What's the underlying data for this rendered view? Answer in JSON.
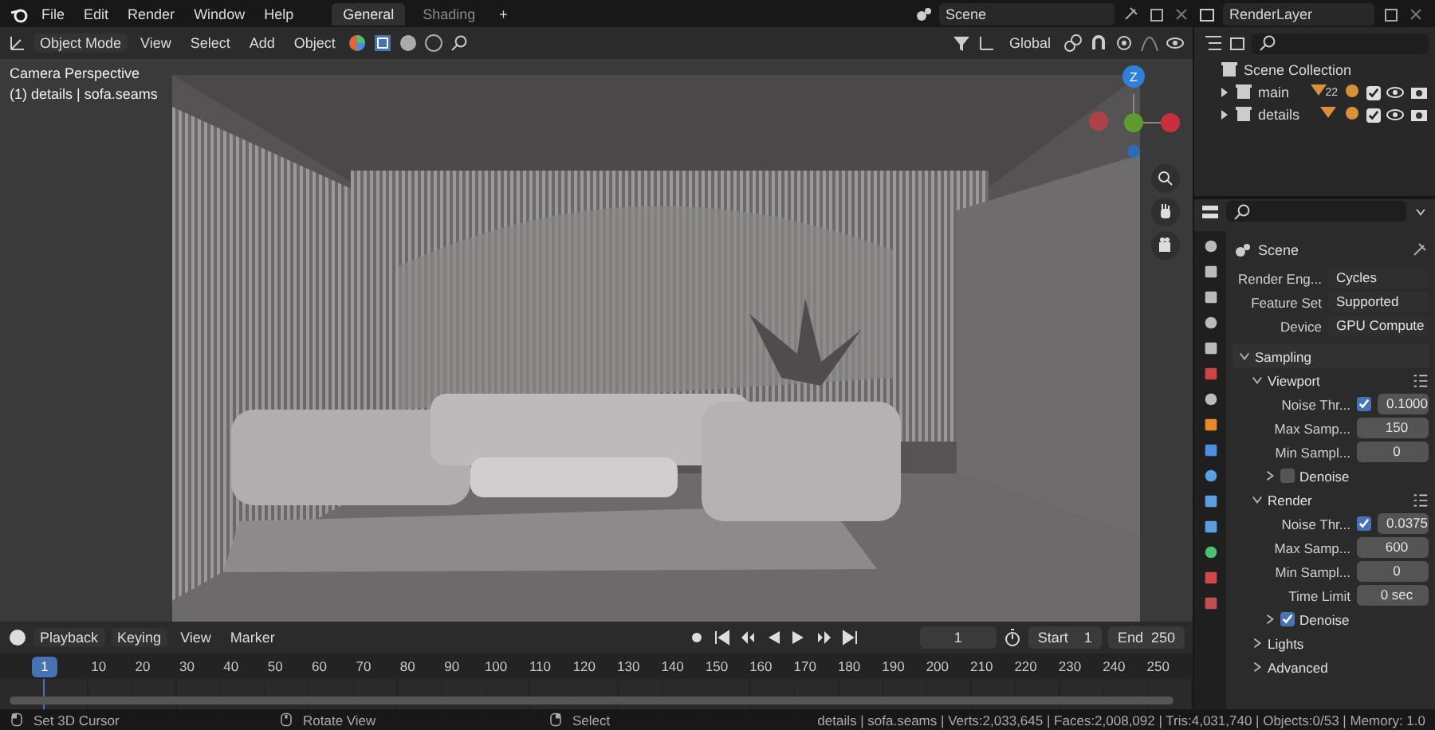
{
  "menubar": {
    "menus": [
      "File",
      "Edit",
      "Render",
      "Window",
      "Help"
    ],
    "workspaces": [
      {
        "label": "General",
        "selected": true
      },
      {
        "label": "Shading",
        "selected": false
      }
    ],
    "add_workspace": "+",
    "scene": "Scene",
    "view_layer": "RenderLayer"
  },
  "viewport": {
    "mode": "Object Mode",
    "menus": [
      "View",
      "Select",
      "Add",
      "Object"
    ],
    "orientation": "Global",
    "title": "Camera Perspective",
    "subtitle": "(1) details | sofa.seams",
    "gizmo_label": "Z"
  },
  "outliner": {
    "root": "Scene Collection",
    "items": [
      {
        "label": "main",
        "expanded": false,
        "count": "22",
        "enabled": true,
        "visible": true
      },
      {
        "label": "details",
        "expanded": false,
        "enabled": true,
        "visible": true
      }
    ]
  },
  "properties": {
    "context": "Scene",
    "fields": [
      {
        "label": "Render Eng...",
        "value": "Cycles"
      },
      {
        "label": "Feature Set",
        "value": "Supported"
      },
      {
        "label": "Device",
        "value": "GPU Compute"
      }
    ],
    "panels": [
      {
        "kind": "panel",
        "label": "Sampling",
        "expanded": true,
        "children": [
          {
            "kind": "panel",
            "label": "Viewport",
            "expanded": true,
            "presets": true,
            "children": [
              {
                "kind": "number",
                "label": "Noise Thr...",
                "checked": true,
                "value": "0.1000"
              },
              {
                "kind": "number",
                "label": "Max Samp...",
                "value": "150"
              },
              {
                "kind": "number",
                "label": "Min Sampl...",
                "value": "0"
              },
              {
                "kind": "panel",
                "label": "Denoise",
                "expanded": false,
                "checked": false
              }
            ]
          },
          {
            "kind": "panel",
            "label": "Render",
            "expanded": true,
            "presets": true,
            "children": [
              {
                "kind": "number",
                "label": "Noise Thr...",
                "checked": true,
                "value": "0.0375"
              },
              {
                "kind": "number",
                "label": "Max Samp...",
                "value": "600"
              },
              {
                "kind": "number",
                "label": "Min Sampl...",
                "value": "0"
              },
              {
                "kind": "number",
                "label": "Time Limit",
                "value": "0 sec"
              },
              {
                "kind": "panel",
                "label": "Denoise",
                "expanded": false,
                "checked": true
              }
            ]
          },
          {
            "kind": "panel",
            "label": "Lights",
            "expanded": false
          },
          {
            "kind": "panel",
            "label": "Advanced",
            "expanded": false
          }
        ]
      }
    ]
  },
  "timeline": {
    "menus": [
      "Playback",
      "Keying",
      "View",
      "Marker"
    ],
    "current_frame": "1",
    "start_label": "Start",
    "start": "1",
    "end_label": "End",
    "end": "250",
    "ruler": {
      "current": "1",
      "labels": [
        "10",
        "20",
        "30",
        "40",
        "50",
        "60",
        "70",
        "80",
        "90",
        "100",
        "110",
        "120",
        "130",
        "140",
        "150",
        "160",
        "170",
        "180",
        "190",
        "200",
        "210",
        "220",
        "230",
        "240",
        "250"
      ]
    }
  },
  "status_bar": {
    "hints": [
      {
        "kind": "left",
        "label": "Set 3D Cursor"
      },
      {
        "kind": "middle",
        "label": "Rotate View"
      },
      {
        "kind": "right",
        "label": "Select"
      }
    ],
    "stats": "details | sofa.seams | Verts:2,033,645 | Faces:2,008,092 | Tris:4,031,740 | Objects:0/53 | Memory: 1.0"
  }
}
